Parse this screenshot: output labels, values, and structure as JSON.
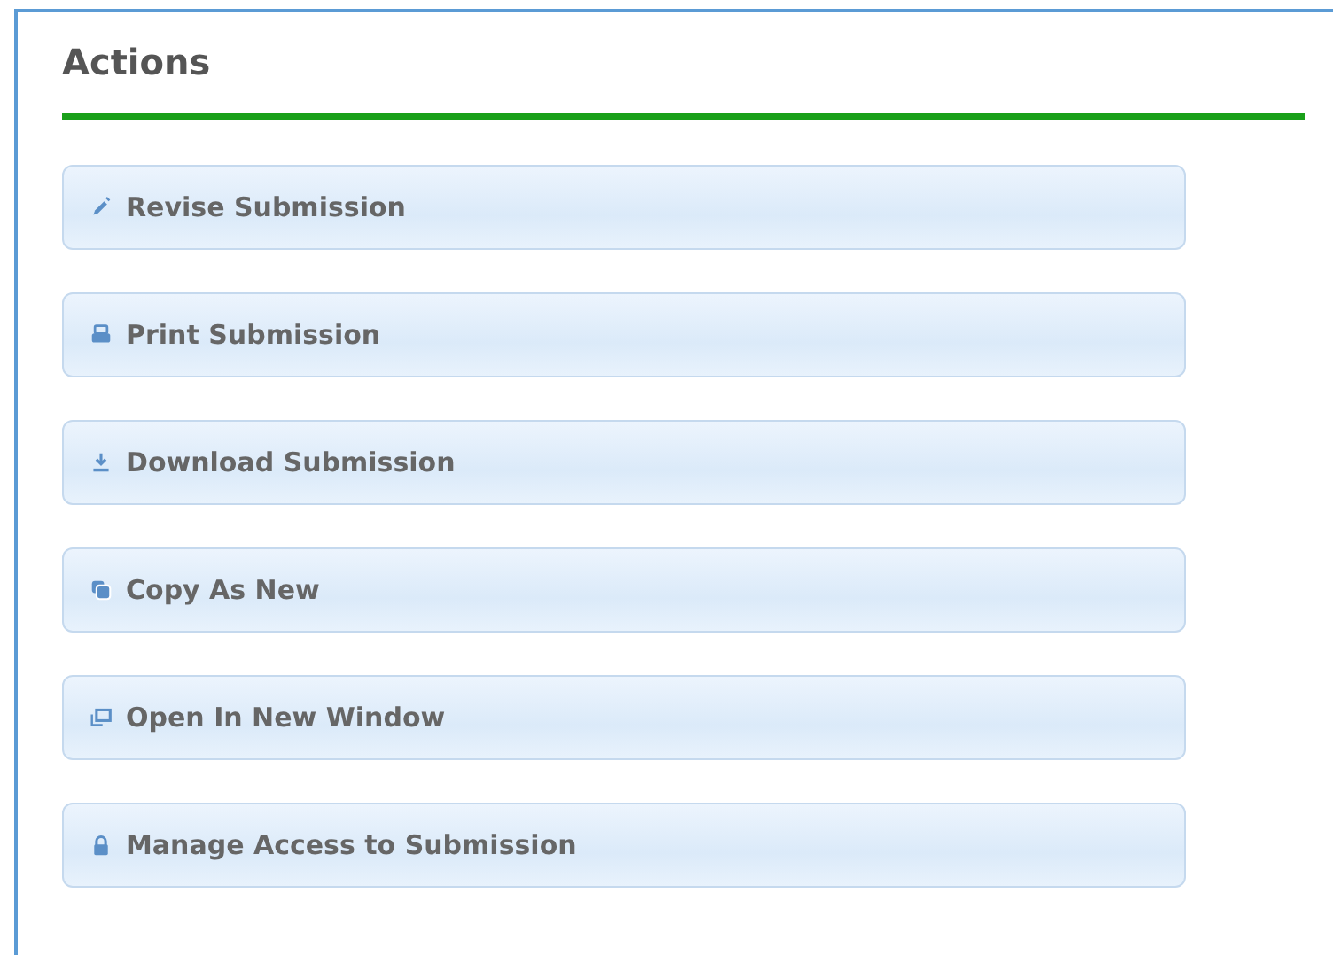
{
  "panel": {
    "title": "Actions"
  },
  "actions": [
    {
      "label": "Revise Submission",
      "kind": "pencil"
    },
    {
      "label": "Print Submission",
      "kind": "printer"
    },
    {
      "label": "Download Submission",
      "kind": "download"
    },
    {
      "label": "Copy As New",
      "kind": "copy"
    },
    {
      "label": "Open In New Window",
      "kind": "window"
    },
    {
      "label": "Manage Access to Submission",
      "kind": "lock"
    }
  ]
}
